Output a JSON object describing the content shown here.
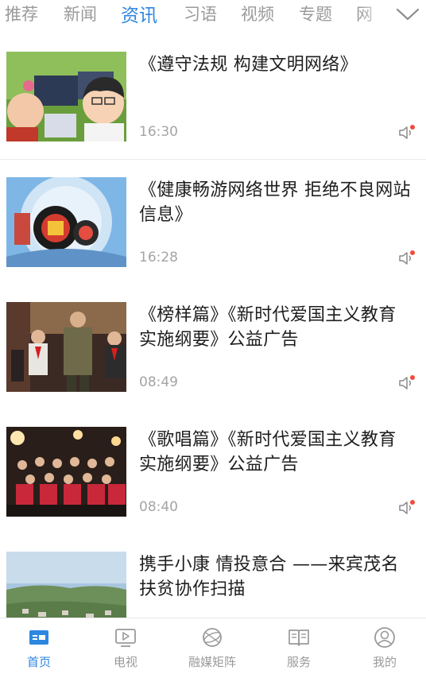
{
  "tabs": {
    "items": [
      "推荐",
      "新闻",
      "资讯",
      "习语",
      "视频",
      "专题",
      "网"
    ],
    "active": "资讯"
  },
  "news": [
    {
      "title": "《遵守法规 构建文明网络》",
      "time": "16:30"
    },
    {
      "title": "《健康畅游网络世界  拒绝不良网站信息》",
      "time": "16:28"
    },
    {
      "title": "《榜样篇》《新时代爱国主义教育实施纲要》公益广告",
      "time": "08:49"
    },
    {
      "title": "《歌唱篇》《新时代爱国主义教育实施纲要》公益广告",
      "time": "08:40"
    },
    {
      "title": "携手小康 情投意合 ——来宾茂名扶贫协作扫描",
      "time": ""
    }
  ],
  "bottom_nav": {
    "items": [
      {
        "label": "首页",
        "icon": "home-icon",
        "active": true
      },
      {
        "label": "电视",
        "icon": "tv-icon",
        "active": false
      },
      {
        "label": "融媒矩阵",
        "icon": "globe-icon",
        "active": false
      },
      {
        "label": "服务",
        "icon": "book-icon",
        "active": false
      },
      {
        "label": "我的",
        "icon": "user-icon",
        "active": false
      }
    ]
  },
  "colors": {
    "accent": "#2d86e0",
    "muted": "#9a9a9a",
    "badge": "#f04b3c"
  }
}
